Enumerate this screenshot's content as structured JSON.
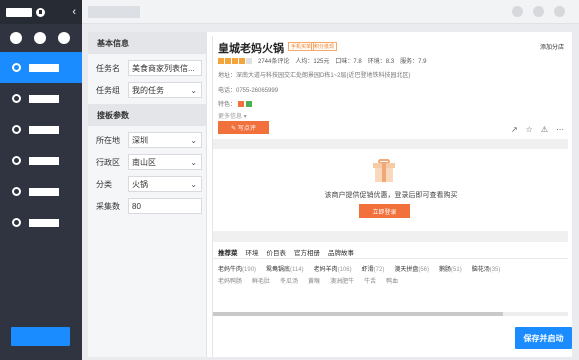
{
  "form": {
    "basic_title": "基本信息",
    "task_name_label": "任务名",
    "task_name_value": "美食商家列表信...",
    "task_group_label": "任务组",
    "task_group_value": "我的任务",
    "params_title": "搜板参数",
    "city_label": "所在地",
    "city_value": "深圳",
    "district_label": "行政区",
    "district_value": "南山区",
    "category_label": "分类",
    "category_value": "火锅",
    "count_label": "采集数",
    "count_value": "80"
  },
  "shop": {
    "name": "皇城老妈火锅",
    "tag1": "手机买单",
    "tag2": "积分抵现",
    "add_compare": "添加分店",
    "reviews": "2744条评论",
    "avg": "人均：125元",
    "taste": "口味：7.8",
    "env": "环境：8.3",
    "service": "服务：7.9",
    "address": "地址：深南大道与科技园交汇处朗景园D栋1~2层(近巴登地铁科技园北区)",
    "phone": "电话：0755-26065999",
    "features_label": "特色：",
    "more_info": "更多信息 ▾",
    "write_review": "✎ 写点评",
    "promo_text": "该商户提供促销优惠，登录后即可查看购买",
    "login_button": "立即登录"
  },
  "tabs": [
    "推荐菜",
    "环境",
    "价目表",
    "官方相册",
    "品牌故事"
  ],
  "dishes_row1": [
    {
      "name": "老妈牛肉",
      "count": "(190)"
    },
    {
      "name": "鸳鸯锅底",
      "count": "(114)"
    },
    {
      "name": "老妈羊肉",
      "count": "(106)"
    },
    {
      "name": "虾滑",
      "count": "(72)"
    },
    {
      "name": "澳天拼盘",
      "count": "(56)"
    },
    {
      "name": "鹅肠",
      "count": "(51)"
    },
    {
      "name": "脑花汤",
      "count": "(35)"
    }
  ],
  "dishes_row2": [
    {
      "name": "老妈鸭肠",
      "count": ""
    },
    {
      "name": "鲜毛肚",
      "count": ""
    },
    {
      "name": "冬瓜汤",
      "count": ""
    },
    {
      "name": "黄喉",
      "count": ""
    },
    {
      "name": "澳洲肥牛",
      "count": ""
    },
    {
      "name": "牛舌",
      "count": ""
    },
    {
      "name": "鸭血",
      "count": ""
    }
  ],
  "save_button": "保存并启动",
  "colors": {
    "accent": "#1a8cff",
    "orange": "#f1703b",
    "sidebar": "#2f3440"
  }
}
